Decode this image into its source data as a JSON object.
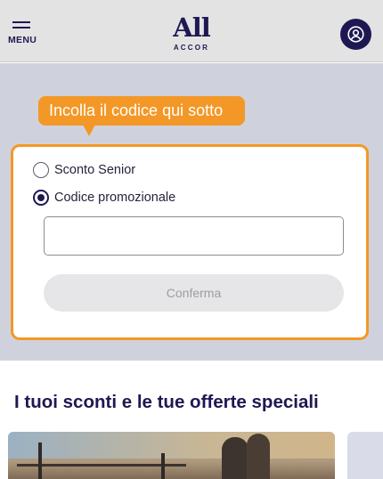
{
  "header": {
    "menu_label": "MENU",
    "logo_main": "All",
    "logo_sub": "ACCOR",
    "menu_icon": "hamburger-icon",
    "account_icon": "user-icon"
  },
  "promo": {
    "tooltip_text": "Incolla il codice qui sotto",
    "options": [
      {
        "label": "Sconto Senior",
        "selected": false
      },
      {
        "label": "Codice promozionale",
        "selected": true
      }
    ],
    "code_input_value": "",
    "confirm_label": "Conferma"
  },
  "offers": {
    "title": "I tuoi sconti e le tue offerte speciali"
  },
  "colors": {
    "brand_navy": "#1e1852",
    "accent_orange": "#f39826",
    "promo_background": "#cfd2dd"
  }
}
